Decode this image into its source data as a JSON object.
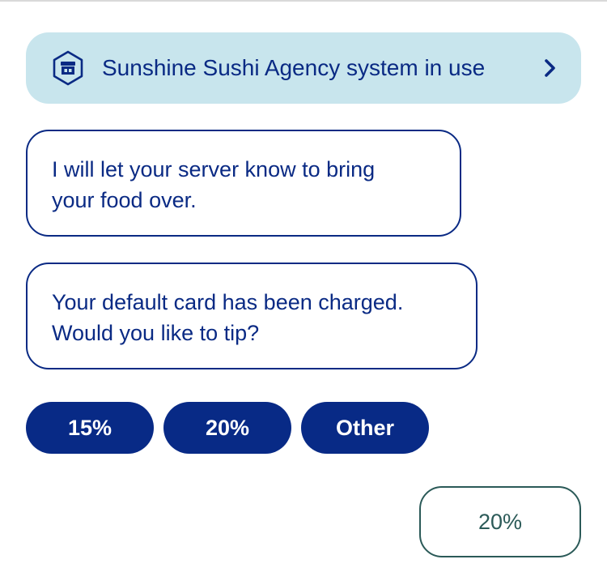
{
  "banner": {
    "label": "Sunshine Sushi Agency system in use",
    "icon": "store-icon"
  },
  "messages": [
    {
      "lines": [
        "I will let your server know to bring",
        "your food over."
      ]
    },
    {
      "lines": [
        "Your default card has been charged.",
        "Would you like to tip?"
      ]
    }
  ],
  "tip_options": {
    "option_15": "15%",
    "option_20": "20%",
    "option_other": "Other"
  },
  "user_reply": "20%",
  "colors": {
    "brand_navy": "#0a2a84",
    "banner_bg": "#c8e5ed",
    "reply_teal": "#2b5a58"
  }
}
